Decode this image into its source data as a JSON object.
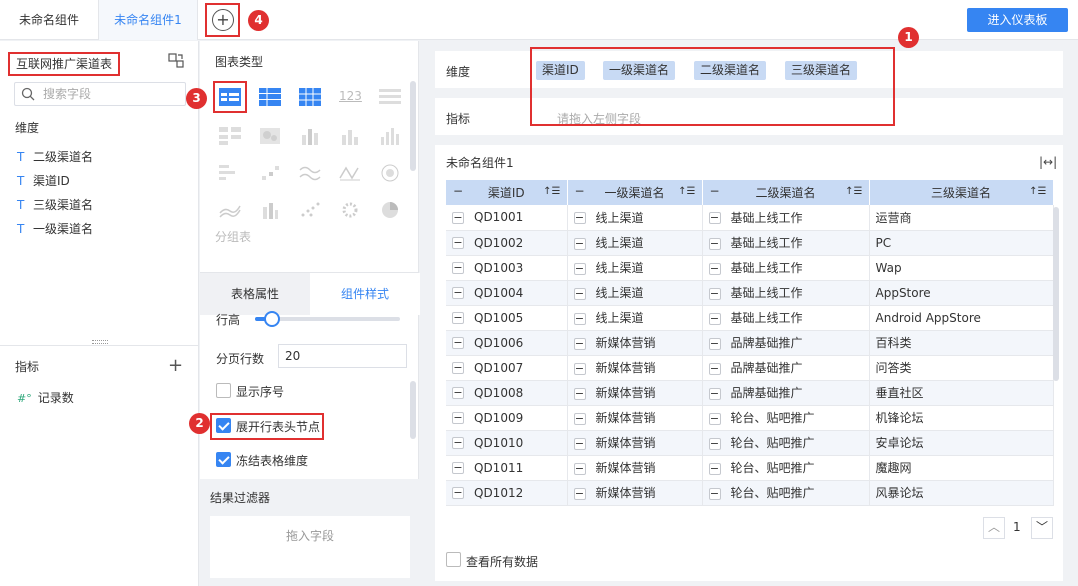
{
  "tabs": [
    {
      "label": "未命名组件"
    },
    {
      "label": "未命名组件1"
    }
  ],
  "enter_dashboard": "进入仪表板",
  "markers": [
    "1",
    "2",
    "3",
    "4"
  ],
  "left": {
    "datasource": "互联网推广渠道表",
    "search_placeholder": "搜索字段",
    "dim_title": "维度",
    "dim_fields": [
      "二级渠道名",
      "渠道ID",
      "三级渠道名",
      "一级渠道名"
    ],
    "field_type_icon": "T",
    "measure_title": "指标",
    "measure_icon": "#°",
    "measure_fields": [
      "记录数"
    ]
  },
  "mid": {
    "chart_type_title": "图表类型",
    "icon_123": "123",
    "group_label": "分组表",
    "prop_tab_a": "表格属性",
    "prop_tab_b": "组件样式",
    "row_height_label": "行高",
    "row_height_level": 0.12,
    "pager_label": "分页行数",
    "pager_value": "20",
    "cb_show_index": "显示序号",
    "cb_expand_header": "展开行表头节点",
    "cb_freeze_dim": "冻结表格维度",
    "filter_title": "结果过滤器",
    "filter_drop": "拖入字段"
  },
  "right": {
    "dim_label": "维度",
    "dim_chips": [
      "渠道ID",
      "一级渠道名",
      "二级渠道名",
      "三级渠道名"
    ],
    "ind_label": "指标",
    "ind_placeholder": "请拖入左侧字段",
    "table_title": "未命名组件1",
    "fit_icon": "|↔|",
    "columns": [
      "渠道ID",
      "一级渠道名",
      "二级渠道名",
      "三级渠道名"
    ],
    "rows": [
      [
        "QD1001",
        "线上渠道",
        "基础上线工作",
        "运营商"
      ],
      [
        "QD1002",
        "线上渠道",
        "基础上线工作",
        "PC"
      ],
      [
        "QD1003",
        "线上渠道",
        "基础上线工作",
        "Wap"
      ],
      [
        "QD1004",
        "线上渠道",
        "基础上线工作",
        "AppStore"
      ],
      [
        "QD1005",
        "线上渠道",
        "基础上线工作",
        "Android AppStore"
      ],
      [
        "QD1006",
        "新媒体营销",
        "品牌基础推广",
        "百科类"
      ],
      [
        "QD1007",
        "新媒体营销",
        "品牌基础推广",
        "问答类"
      ],
      [
        "QD1008",
        "新媒体营销",
        "品牌基础推广",
        "垂直社区"
      ],
      [
        "QD1009",
        "新媒体营销",
        "轮台、贴吧推广",
        "机锋论坛"
      ],
      [
        "QD1010",
        "新媒体营销",
        "轮台、贴吧推广",
        "安卓论坛"
      ],
      [
        "QD1011",
        "新媒体营销",
        "轮台、贴吧推广",
        "魔趣网"
      ],
      [
        "QD1012",
        "新媒体营销",
        "轮台、贴吧推广",
        "风暴论坛"
      ]
    ],
    "page": "1",
    "view_all": "查看所有数据"
  },
  "colors": {
    "accent": "#3685f2",
    "highlight": "#e03030",
    "chip": "#c8daf4"
  }
}
